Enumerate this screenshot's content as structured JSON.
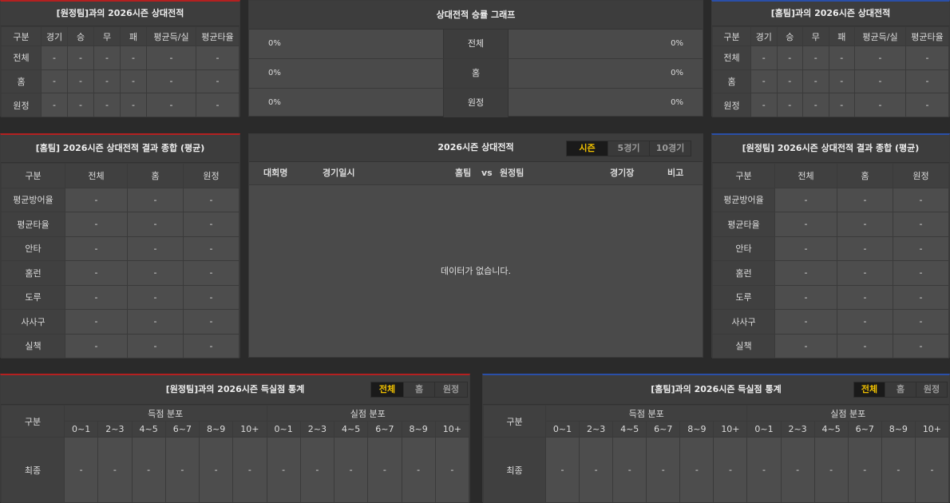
{
  "top_left": {
    "title": "[원정팀]과의 2026시즌 상대전적",
    "headers": [
      "구분",
      "경기",
      "승",
      "무",
      "패",
      "평균득/실",
      "평균타율"
    ],
    "rows": [
      [
        "전체",
        "-",
        "-",
        "-",
        "-",
        "-",
        "-"
      ],
      [
        "홈",
        "-",
        "-",
        "-",
        "-",
        "-",
        "-"
      ],
      [
        "원정",
        "-",
        "-",
        "-",
        "-",
        "-",
        "-"
      ]
    ]
  },
  "top_right": {
    "title": "[홈팀]과의 2026시즌 상대전적",
    "headers": [
      "구분",
      "경기",
      "승",
      "무",
      "패",
      "평균득/실",
      "평균타율"
    ],
    "rows": [
      [
        "전체",
        "-",
        "-",
        "-",
        "-",
        "-",
        "-"
      ],
      [
        "홈",
        "-",
        "-",
        "-",
        "-",
        "-",
        "-"
      ],
      [
        "원정",
        "-",
        "-",
        "-",
        "-",
        "-",
        "-"
      ]
    ]
  },
  "graph": {
    "title": "상대전적 승률 그래프",
    "rows": [
      {
        "label": "전체",
        "left": "0%",
        "right": "0%"
      },
      {
        "label": "홈",
        "left": "0%",
        "right": "0%"
      },
      {
        "label": "원정",
        "left": "0%",
        "right": "0%"
      }
    ]
  },
  "mid_left": {
    "title": "[홈팀] 2026시즌 상대전적 결과 종합 (평균)",
    "headers": [
      "구분",
      "전체",
      "홈",
      "원정"
    ],
    "rows": [
      [
        "평균방어율",
        "-",
        "-",
        "-"
      ],
      [
        "평균타율",
        "-",
        "-",
        "-"
      ],
      [
        "안타",
        "-",
        "-",
        "-"
      ],
      [
        "홈런",
        "-",
        "-",
        "-"
      ],
      [
        "도루",
        "-",
        "-",
        "-"
      ],
      [
        "사사구",
        "-",
        "-",
        "-"
      ],
      [
        "실책",
        "-",
        "-",
        "-"
      ]
    ]
  },
  "mid_right": {
    "title": "[원정팀] 2026시즌 상대전적 결과 종합 (평균)",
    "headers": [
      "구분",
      "전체",
      "홈",
      "원정"
    ],
    "rows": [
      [
        "평균방어율",
        "-",
        "-",
        "-"
      ],
      [
        "평균타율",
        "-",
        "-",
        "-"
      ],
      [
        "안타",
        "-",
        "-",
        "-"
      ],
      [
        "홈런",
        "-",
        "-",
        "-"
      ],
      [
        "도루",
        "-",
        "-",
        "-"
      ],
      [
        "사사구",
        "-",
        "-",
        "-"
      ],
      [
        "실책",
        "-",
        "-",
        "-"
      ]
    ]
  },
  "season": {
    "title": "2026시즌 상대전적",
    "tabs": [
      "시즌",
      "5경기",
      "10경기"
    ],
    "headers": {
      "league": "대회명",
      "date": "경기일시",
      "home": "홈팀",
      "vs": "vs",
      "away": "원정팀",
      "stadium": "경기장",
      "note": "비고"
    },
    "empty_message": "데이터가 없습니다."
  },
  "bottom_left": {
    "title": "[원정팀]과의 2026시즌 득실점 통계",
    "tabs": [
      "전체",
      "홈",
      "원정"
    ],
    "label_col": "구분",
    "group1": "득점 분포",
    "group2": "실점 분포",
    "ranges": [
      "0~1",
      "2~3",
      "4~5",
      "6~7",
      "8~9",
      "10+"
    ],
    "row_label": "최종",
    "values": [
      "-",
      "-",
      "-",
      "-",
      "-",
      "-",
      "-",
      "-",
      "-",
      "-",
      "-",
      "-"
    ]
  },
  "bottom_right": {
    "title": "[홈팀]과의 2026시즌 득실점 통계",
    "tabs": [
      "전체",
      "홈",
      "원정"
    ],
    "label_col": "구분",
    "group1": "득점 분포",
    "group2": "실점 분포",
    "ranges": [
      "0~1",
      "2~3",
      "4~5",
      "6~7",
      "8~9",
      "10+"
    ],
    "row_label": "최종",
    "values": [
      "-",
      "-",
      "-",
      "-",
      "-",
      "-",
      "-",
      "-",
      "-",
      "-",
      "-",
      "-"
    ]
  },
  "colors": {
    "accent_active": "#f2c200",
    "home_border": "#b42020",
    "away_border": "#2a4fa8"
  }
}
